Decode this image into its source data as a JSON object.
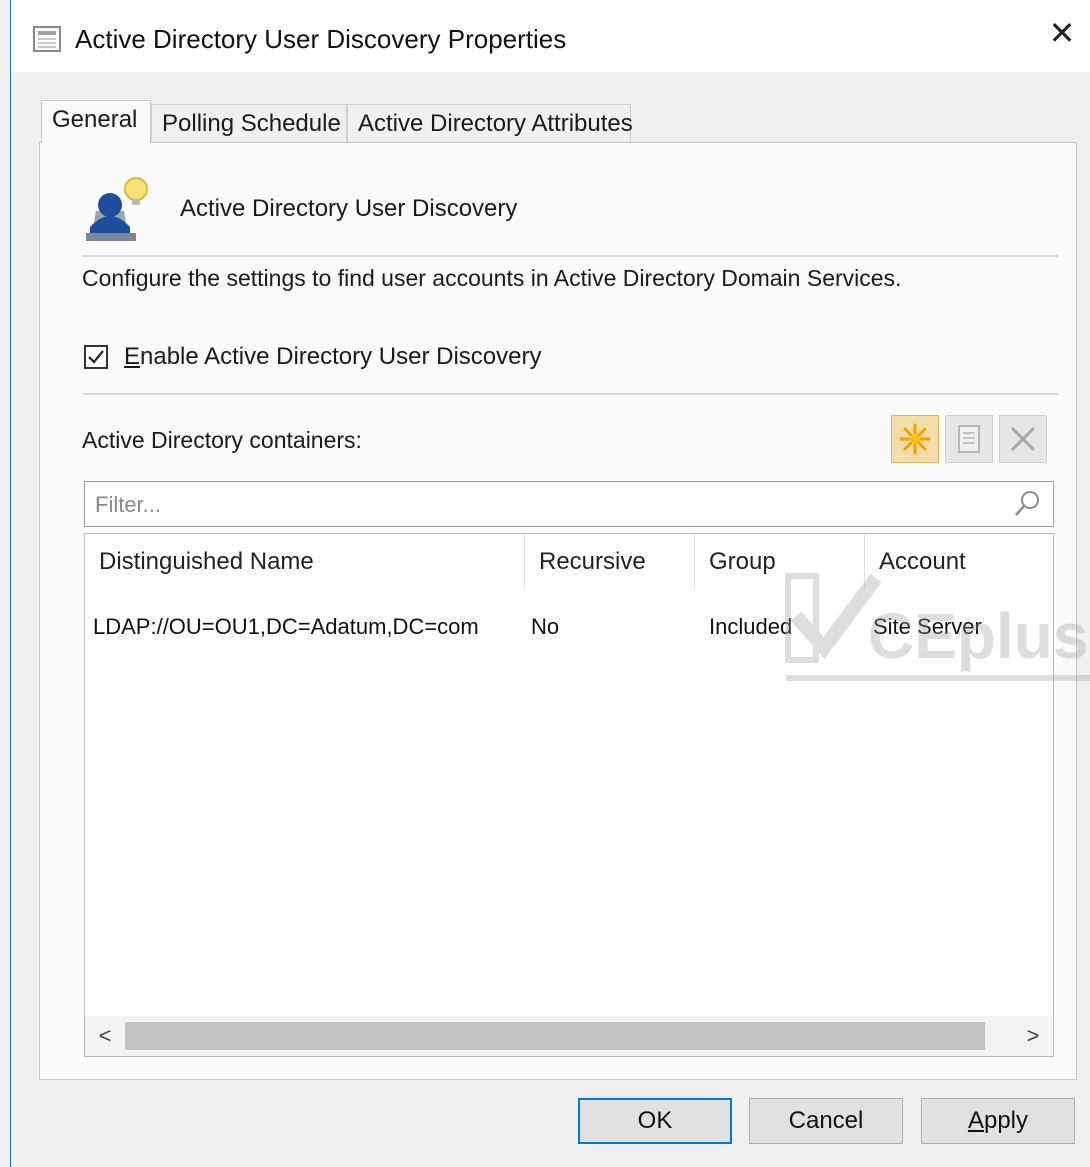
{
  "window": {
    "title": "Active Directory User Discovery Properties",
    "close_label": "✕"
  },
  "tabs": [
    {
      "label": "General",
      "active": true
    },
    {
      "label": "Polling Schedule",
      "active": false
    },
    {
      "label": "Active Directory Attributes",
      "active": false
    }
  ],
  "general": {
    "header_label": "Active Directory User Discovery",
    "description": "Configure the settings to find user accounts in Active Directory Domain Services.",
    "enable_checkbox": {
      "label": "Enable Active Directory User Discovery",
      "checked": true
    },
    "containers_label": "Active Directory containers:",
    "toolbar": {
      "new_icon": "new-star-icon",
      "edit_icon": "edit-document-icon",
      "delete_icon": "delete-x-icon"
    },
    "filter": {
      "placeholder": "Filter...",
      "value": ""
    },
    "columns": [
      "Distinguished Name",
      "Recursive",
      "Group",
      "Account"
    ],
    "rows": [
      {
        "distinguished_name": "LDAP://OU=OU1,DC=Adatum,DC=com",
        "recursive": "No",
        "group": "Included",
        "account": "Site Server"
      }
    ],
    "scroll": {
      "left": "<",
      "right": ">"
    }
  },
  "buttons": {
    "ok": "OK",
    "cancel": "Cancel",
    "apply": "Apply"
  },
  "watermark": "CEplus",
  "colors": {
    "accent": "#0078d7",
    "window_border": "#2b6cb0",
    "new_button_bg": "#f3dca5"
  }
}
